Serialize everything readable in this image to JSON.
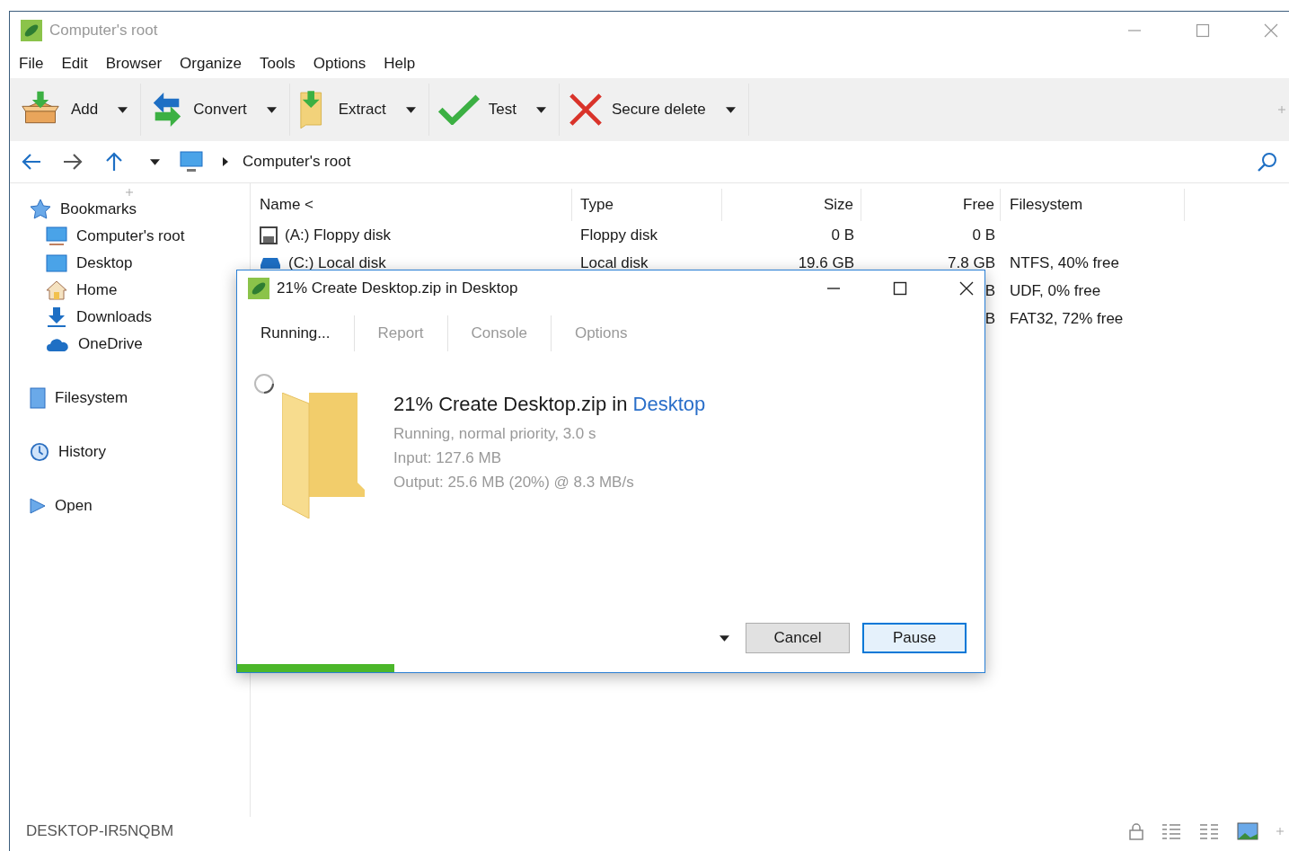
{
  "window": {
    "title": "Computer's root"
  },
  "menu": [
    "File",
    "Edit",
    "Browser",
    "Organize",
    "Tools",
    "Options",
    "Help"
  ],
  "toolbar": [
    {
      "label": "Add"
    },
    {
      "label": "Convert"
    },
    {
      "label": "Extract"
    },
    {
      "label": "Test"
    },
    {
      "label": "Secure delete"
    }
  ],
  "address": {
    "path": "Computer's root"
  },
  "sidebar": {
    "items": [
      {
        "label": "Bookmarks",
        "children": [
          {
            "label": "Computer's root"
          },
          {
            "label": "Desktop"
          },
          {
            "label": "Home"
          },
          {
            "label": "Downloads"
          },
          {
            "label": "OneDrive"
          }
        ]
      },
      {
        "label": "Filesystem"
      },
      {
        "label": "History"
      },
      {
        "label": "Open"
      }
    ]
  },
  "table": {
    "columns": [
      "Name <",
      "Type",
      "Size",
      "Free",
      "Filesystem"
    ],
    "rows": [
      {
        "name": "(A:) Floppy disk",
        "type": "Floppy disk",
        "size": "0 B",
        "free": "0 B",
        "filesystem": ""
      },
      {
        "name": "(C:) Local disk",
        "type": "Local disk",
        "size": "19.6 GB",
        "free": "7.8 GB",
        "filesystem": "NTFS, 40% free"
      },
      {
        "name": "",
        "type": "",
        "size": "",
        "free": "B",
        "filesystem": "UDF, 0% free"
      },
      {
        "name": "",
        "type": "",
        "size": "",
        "free": "B",
        "filesystem": "FAT32, 72% free"
      }
    ]
  },
  "dialog": {
    "title": "21% Create Desktop.zip in Desktop",
    "tabs": [
      {
        "label": "Running...",
        "selected": true
      },
      {
        "label": "Report",
        "selected": false
      },
      {
        "label": "Console",
        "selected": false
      },
      {
        "label": "Options",
        "selected": false
      }
    ],
    "heading": "21% Create Desktop.zip in",
    "heading_link": "Desktop",
    "details": [
      "Running, normal priority, 3.0 s",
      "Input: 127.6 MB",
      "Output: 25.6 MB (20%) @ 8.3 MB/s"
    ],
    "buttons": [
      "Cancel",
      "Pause"
    ],
    "progress": {
      "level": 0.21
    }
  },
  "status_bar": {
    "computer": "DESKTOP-IR5NQBM"
  }
}
